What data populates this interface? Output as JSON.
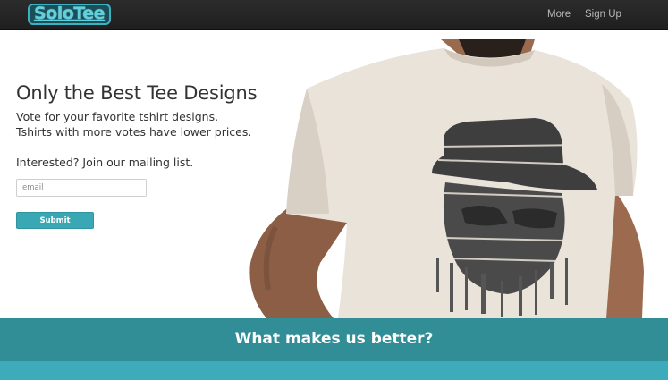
{
  "navbar": {
    "logo_text": "SoloTee",
    "links": [
      {
        "label": "More"
      },
      {
        "label": "Sign Up"
      }
    ]
  },
  "hero": {
    "title": "Only the Best Tee Designs",
    "subtitle_line1": "Vote for your favorite tshirt designs.",
    "subtitle_line2": "Tshirts with more votes have lower prices.",
    "mailing_prompt": "Interested? Join our mailing list.",
    "email_placeholder": "email",
    "email_value": "",
    "submit_label": "Submit"
  },
  "features": {
    "heading": "What makes us better?"
  },
  "colors": {
    "brand_teal": "#3aa8b4",
    "band_teal": "#318d96",
    "navbar_bg": "#2c2c2c"
  }
}
